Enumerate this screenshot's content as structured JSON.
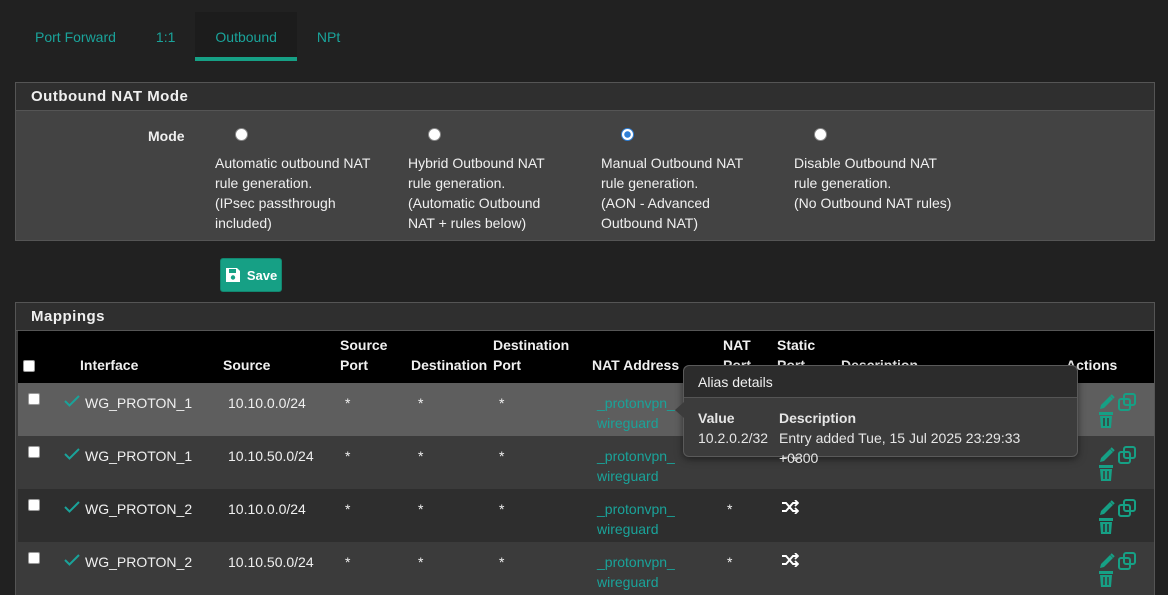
{
  "tabs": [
    "Port Forward",
    "1:1",
    "Outbound",
    "NPt"
  ],
  "mode_panel": {
    "title": "Outbound NAT Mode",
    "label": "Mode",
    "options": [
      {
        "text": "Automatic outbound NAT\nrule generation.\n(IPsec passthrough\nincluded)",
        "checked": false
      },
      {
        "text": "Hybrid Outbound NAT\nrule generation.\n(Automatic Outbound\nNAT + rules below)",
        "checked": false
      },
      {
        "text": "Manual Outbound NAT\nrule generation.\n(AON - Advanced\nOutbound NAT)",
        "checked": true
      },
      {
        "text": "Disable Outbound NAT\nrule generation.\n(No Outbound NAT rules)",
        "checked": false
      }
    ]
  },
  "save_label": "Save",
  "mappings": {
    "title": "Mappings",
    "headers": {
      "interface": "Interface",
      "source": "Source",
      "source_port": "Source\nPort",
      "destination": "Destination",
      "destination_port": "Destination\nPort",
      "nat_address": "NAT Address",
      "nat_port": "NAT\nPort",
      "static_port": "Static\nPort",
      "description": "Description",
      "actions": "Actions"
    },
    "rows": [
      {
        "interface": "WG_PROTON_1",
        "source": "10.10.0.0/24",
        "source_port": "*",
        "destination": "*",
        "destination_port": "*",
        "nat_address": "_protonvpn_\nwireguard",
        "nat_port": "",
        "static_port": false
      },
      {
        "interface": "WG_PROTON_1",
        "source": "10.10.50.0/24",
        "source_port": "*",
        "destination": "*",
        "destination_port": "*",
        "nat_address": "_protonvpn_\nwireguard",
        "nat_port": "",
        "static_port": true
      },
      {
        "interface": "WG_PROTON_2",
        "source": "10.10.0.0/24",
        "source_port": "*",
        "destination": "*",
        "destination_port": "*",
        "nat_address": "_protonvpn_\nwireguard",
        "nat_port": "*",
        "static_port": true
      },
      {
        "interface": "WG_PROTON_2",
        "source": "10.10.50.0/24",
        "source_port": "*",
        "destination": "*",
        "destination_port": "*",
        "nat_address": "_protonvpn_\nwireguard",
        "nat_port": "*",
        "static_port": true
      }
    ]
  },
  "tooltip": {
    "title": "Alias details",
    "value_header": "Value",
    "description_header": "Description",
    "value": "10.2.0.2/32",
    "description": "Entry added Tue, 15 Jul 2025 23:29:33 +0300"
  },
  "colors": {
    "accent": "#16a085",
    "link": "#1aa39a",
    "radio_checked": "#2f7fd6"
  }
}
